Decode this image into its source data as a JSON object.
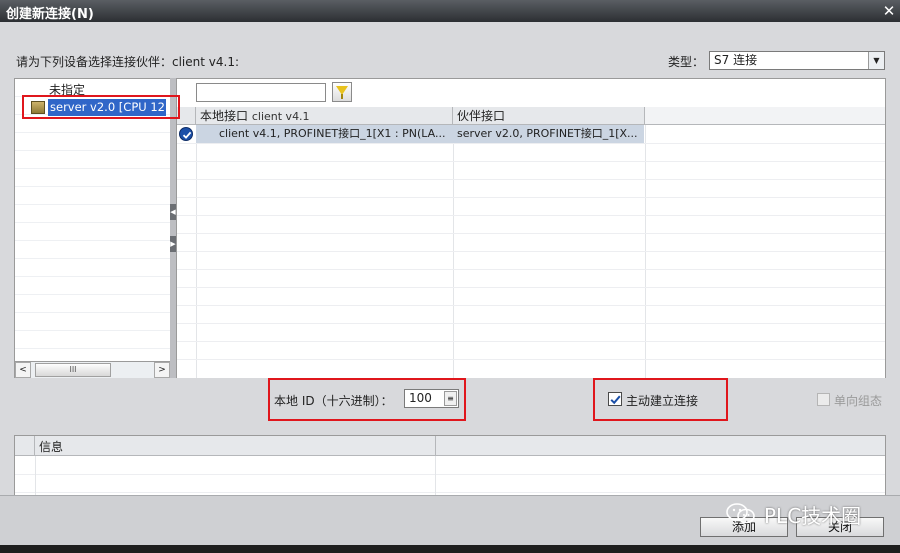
{
  "window": {
    "title": "创建新连接(N)",
    "close_glyph": "✕"
  },
  "header": {
    "select_prompt": "请为下列设备选择连接伙伴：client v4.1:",
    "type_label": "类型：",
    "type_value": "S7 连接",
    "type_arrow": "▼"
  },
  "tree": {
    "unspecified": "未指定",
    "server_item": "server v2.0 [CPU 12..."
  },
  "scroll": {
    "left": "<",
    "right": ">",
    "thumb_grip": "III"
  },
  "grid": {
    "col_local": "本地接口",
    "col_local_sub": "client v4.1",
    "col_partner": "伙伴接口",
    "row_local": "client v4.1, PROFINET接口_1[X1 : PN(LA...",
    "row_partner": "server v2.0, PROFINET接口_1[X..."
  },
  "options": {
    "local_id_label": "本地 ID（十六进制）：",
    "local_id_value": "100",
    "active_label": "主动建立连接",
    "active_checked": true,
    "oneway_label": "单向组态",
    "oneway_checked": false
  },
  "info": {
    "title": "信息"
  },
  "footer": {
    "add_button": "添加",
    "close_button": "关闭"
  },
  "watermark": {
    "text": "PLC技术圈"
  },
  "colors": {
    "selection": "#3066c8",
    "highlight_box": "#e0161c",
    "check_blue": "#1b4fa8"
  }
}
